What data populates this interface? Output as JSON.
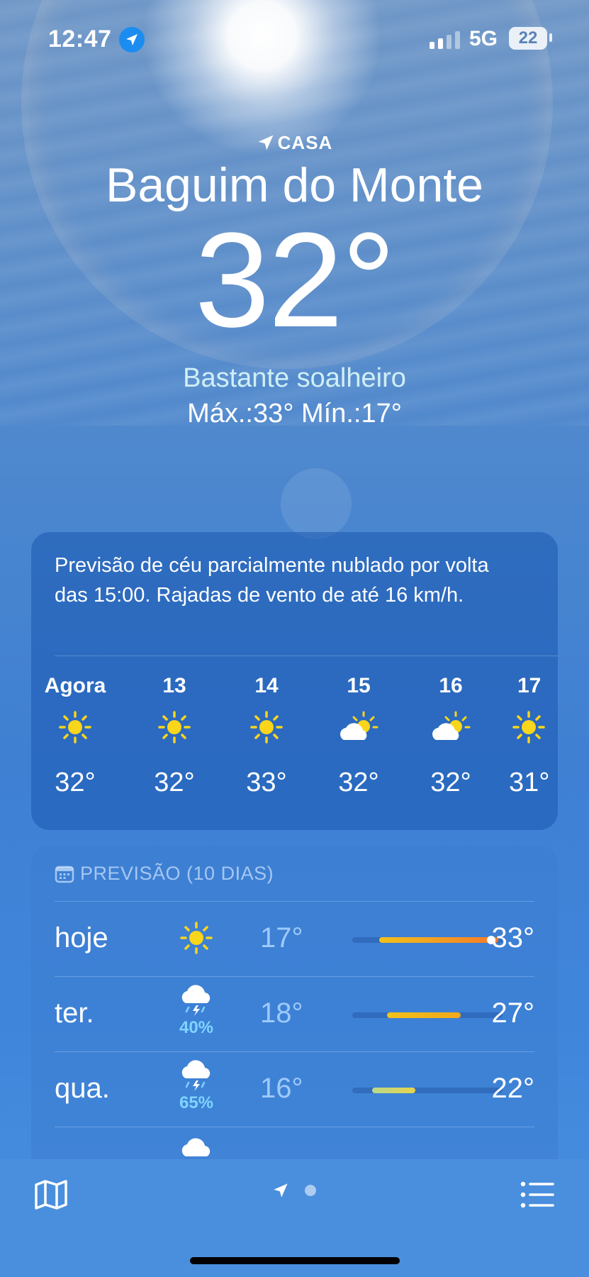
{
  "status": {
    "time": "12:47",
    "network": "5G",
    "battery": "22"
  },
  "header": {
    "home_label": "CASA",
    "city": "Baguim do Monte",
    "temperature": "32°",
    "condition": "Bastante soalheiro",
    "hilo": "Máx.:33°  Mín.:17°"
  },
  "hourly": {
    "summary": "Previsão de céu parcialmente nublado por volta das 15:00. Rajadas de vento de até 16 km/h.",
    "items": [
      {
        "label": "Agora",
        "icon": "sun-icon",
        "temp": "32°"
      },
      {
        "label": "13",
        "icon": "sun-icon",
        "temp": "32°"
      },
      {
        "label": "14",
        "icon": "sun-icon",
        "temp": "33°"
      },
      {
        "label": "15",
        "icon": "partly-cloudy-icon",
        "temp": "32°"
      },
      {
        "label": "16",
        "icon": "partly-cloudy-icon",
        "temp": "32°"
      },
      {
        "label": "17",
        "icon": "sun-icon",
        "temp": "31°"
      }
    ]
  },
  "daily": {
    "header": "PREVISÃO (10 DIAS)",
    "rows": [
      {
        "day": "hoje",
        "icon": "sun-icon",
        "pop": "",
        "low": "17°",
        "high": "33°",
        "bar_start": 0.18,
        "bar_end": 0.97,
        "colors": [
          "#f2c11a",
          "#f47a2a"
        ]
      },
      {
        "day": "ter.",
        "icon": "thunderstorm-icon",
        "pop": "40%",
        "low": "18°",
        "high": "27°",
        "bar_start": 0.23,
        "bar_end": 0.72,
        "colors": [
          "#f2c11a",
          "#f2a81a"
        ]
      },
      {
        "day": "qua.",
        "icon": "thunderstorm-icon",
        "pop": "65%",
        "low": "16°",
        "high": "22°",
        "bar_start": 0.13,
        "bar_end": 0.42,
        "colors": [
          "#b9d98b",
          "#e8d34a"
        ]
      }
    ]
  },
  "toolbar": {
    "map_icon": "map-icon",
    "location_icon": "location-arrow-icon",
    "list_icon": "list-icon"
  },
  "colors": {
    "accent_blue": "#1b8cf0",
    "sun_yellow": "#f9d51b"
  }
}
